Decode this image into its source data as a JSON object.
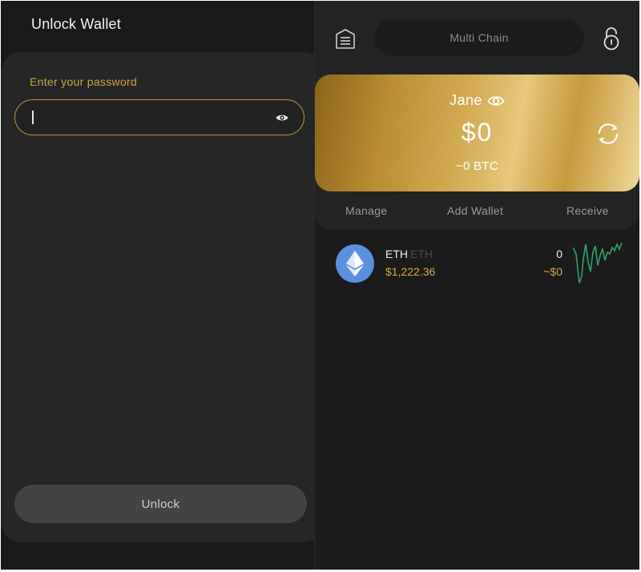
{
  "unlock": {
    "title": "Unlock Wallet",
    "password_label": "Enter your password",
    "password_value": "",
    "unlock_label": "Unlock"
  },
  "header": {
    "chain_label": "Multi Chain"
  },
  "card": {
    "name": "Jane",
    "balance": "$0",
    "btc_balance": "~0 BTC"
  },
  "actions": {
    "manage": "Manage",
    "add_wallet": "Add Wallet",
    "receive": "Receive"
  },
  "assets": [
    {
      "symbol": "ETH",
      "sub_symbol": "ETH",
      "price": "$1,222.36",
      "quantity": "0",
      "value": "~$0",
      "icon": "ethereum-icon"
    }
  ],
  "colors": {
    "gold": "#c9a246",
    "background": "#1b1b1b",
    "eth_blue": "#5b8fe0",
    "sparkline": "#2fa36b"
  }
}
